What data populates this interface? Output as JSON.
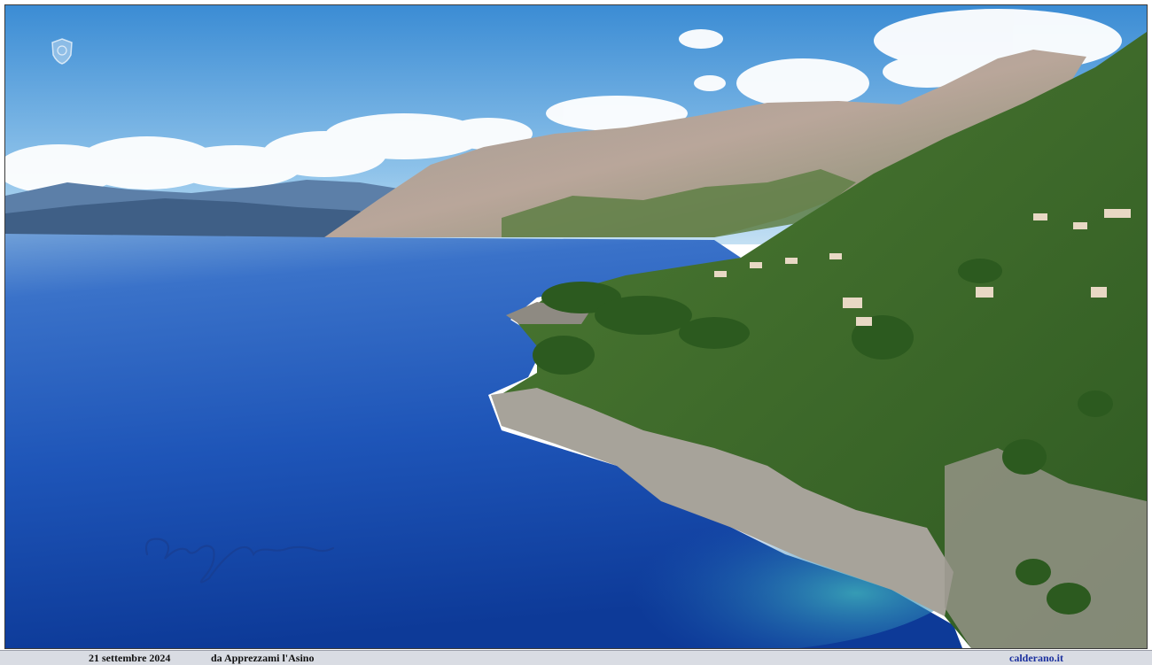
{
  "caption": {
    "date": "21 settembre 2024",
    "place": "da Apprezzami l'Asino",
    "site": "calderano.it"
  },
  "colors": {
    "sky_top": "#3d8fd6",
    "sky_bottom": "#a9d2ef",
    "sea_deep": "#0f3f9e",
    "sea_mid": "#2a64c6",
    "turquoise": "#2f9fb8",
    "rock": "#b4b0a8",
    "vegetation": "#3f6b2a",
    "caption_bar": "#d9dce3",
    "site_text": "#1a2f9e"
  },
  "decorations": {
    "logo_icon": "shield-seal-icon",
    "signature_icon": "handwritten-signature-icon"
  }
}
